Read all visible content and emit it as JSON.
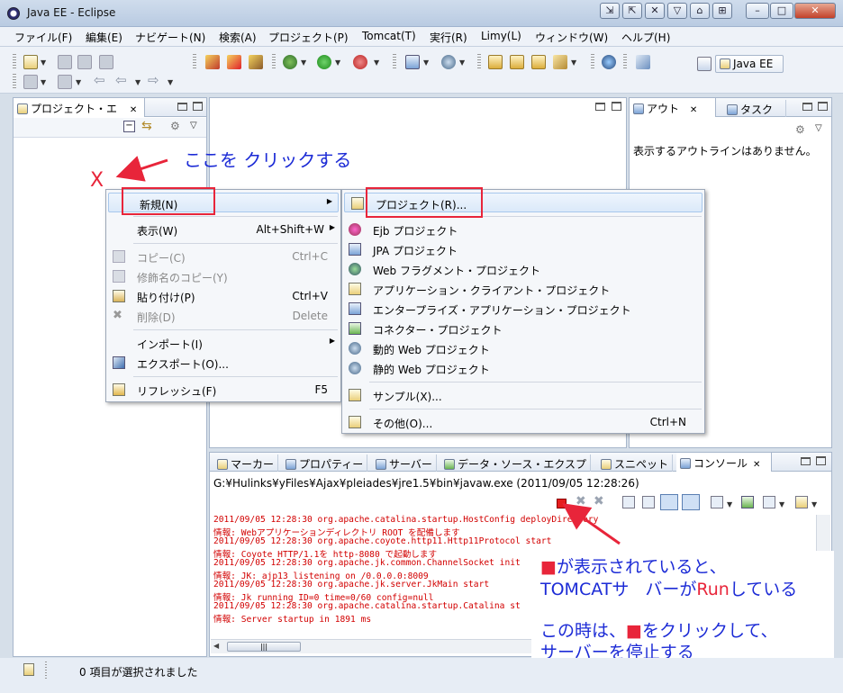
{
  "window": {
    "title": "Java EE - Eclipse"
  },
  "menubar": {
    "items": [
      "ファイル(F)",
      "編集(E)",
      "ナビゲート(N)",
      "検索(A)",
      "プロジェクト(P)",
      "Tomcat(T)",
      "実行(R)",
      "Limy(L)",
      "ウィンドウ(W)",
      "ヘルプ(H)"
    ]
  },
  "toolbar": {
    "perspective_label": "Java EE"
  },
  "project_explorer": {
    "tab_label": "プロジェクト・エ"
  },
  "outline": {
    "tab_label": "アウト",
    "tab2_label": "タスク",
    "empty_message": "表示するアウトラインはありません。"
  },
  "context_menu": {
    "new": "新規(N)",
    "show": "表示(W)",
    "show_accel": "Alt+Shift+W",
    "copy": "コピー(C)",
    "copy_accel": "Ctrl+C",
    "copy_qualified": "修飾名のコピー(Y)",
    "paste": "貼り付け(P)",
    "paste_accel": "Ctrl+V",
    "delete": "削除(D)",
    "delete_accel": "Delete",
    "import": "インポート(I)",
    "export": "エクスポート(O)...",
    "refresh": "リフレッシュ(F)",
    "refresh_accel": "F5"
  },
  "submenu": {
    "project": "プロジェクト(R)...",
    "ejb": "Ejb プロジェクト",
    "jpa": "JPA プロジェクト",
    "web_fragment": "Web フラグメント・プロジェクト",
    "app_client": "アプリケーション・クライアント・プロジェクト",
    "enterprise_app": "エンタープライズ・アプリケーション・プロジェクト",
    "connector": "コネクター・プロジェクト",
    "dynamic_web": "動的 Web プロジェクト",
    "static_web": "静的 Web プロジェクト",
    "sample": "サンプル(X)...",
    "other": "その他(O)...",
    "other_accel": "Ctrl+N"
  },
  "bottom_tabs": [
    "マーカー",
    "プロパティー",
    "サーバー",
    "データ・ソース・エクスプ",
    "スニペット",
    "コンソール"
  ],
  "console": {
    "header": "G:¥Hulinks¥yFiles¥Ajax¥pleiades¥jre1.5¥bin¥javaw.exe (2011/09/05 12:28:26)",
    "lines": [
      "2011/09/05 12:28:30 org.apache.catalina.startup.HostConfig deployDirectory",
      "情報: Webアプリケーションディレクトリ ROOT を配備します",
      "2011/09/05 12:28:30 org.apache.coyote.http11.Http11Protocol start",
      "情報: Coyote HTTP/1.1を http-8080 で起動します",
      "2011/09/05 12:28:30 org.apache.jk.common.ChannelSocket init",
      "情報: JK: ajp13 listening on /0.0.0.0:8009",
      "2011/09/05 12:28:30 org.apache.jk.server.JkMain start",
      "情報: Jk running ID=0 time=0/60  config=null",
      "2011/09/05 12:28:30 org.apache.catalina.startup.Catalina st",
      "情報: Server startup in 1891 ms"
    ]
  },
  "annotations": {
    "x_mark": "X",
    "click_here": "ここを クリックする",
    "line1_square": "■",
    "line1_text": "が表示されていると、",
    "line2_a": "TOMCATサ",
    "line2_b": "バーが",
    "line2_run": "Run",
    "line2_c": "している",
    "line3_a": "この時は、",
    "line3_square": "■",
    "line3_b": "をクリックして、",
    "line4": "サーバーを停止する"
  },
  "statusbar": {
    "text": "0 項目が選択されました"
  },
  "colors": {
    "annotation_blue": "#1c2bd6",
    "annotation_red": "#e8253a",
    "console_red": "#d20000"
  }
}
